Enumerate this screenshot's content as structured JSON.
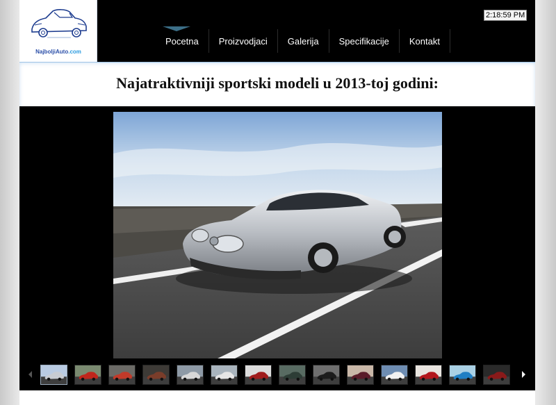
{
  "site": {
    "logo_text_part1": "Najbolji",
    "logo_text_part2": "Auto",
    "logo_text_part3": ".com",
    "clock": "2:18:59 PM"
  },
  "nav": {
    "items": [
      {
        "label": "Pocetna",
        "active": true
      },
      {
        "label": "Proizvodjaci"
      },
      {
        "label": "Galerija"
      },
      {
        "label": "Specifikacije"
      },
      {
        "label": "Kontakt"
      }
    ]
  },
  "main": {
    "title": "Najatraktivniji sportski modeli u 2013-toj godini:"
  },
  "gallery": {
    "main_image_icon": "silver-sports-car-photo",
    "thumbnails": [
      {
        "name": "thumb-1",
        "color": "#c8ccd2",
        "sky": "#b9cbe2",
        "active": true
      },
      {
        "name": "thumb-2",
        "color": "#c0261c",
        "sky": "#7a8a70"
      },
      {
        "name": "thumb-3",
        "color": "#c23a2a",
        "sky": "#6b6a66"
      },
      {
        "name": "thumb-4",
        "color": "#7a3d2a",
        "sky": "#3d3a36"
      },
      {
        "name": "thumb-5",
        "color": "#d8d8d8",
        "sky": "#8e9aa6"
      },
      {
        "name": "thumb-6",
        "color": "#e6e6e6",
        "sky": "#a9b4bd"
      },
      {
        "name": "thumb-7",
        "color": "#a01c1c",
        "sky": "#dcdcdc"
      },
      {
        "name": "thumb-8",
        "color": "#2d3d36",
        "sky": "#586b62"
      },
      {
        "name": "thumb-9",
        "color": "#1c1c1c",
        "sky": "#6e6e6e"
      },
      {
        "name": "thumb-10",
        "color": "#5a1c2a",
        "sky": "#c9b7a8"
      },
      {
        "name": "thumb-11",
        "color": "#f2f2f2",
        "sky": "#6e8db2"
      },
      {
        "name": "thumb-12",
        "color": "#b3171c",
        "sky": "#e8e4df"
      },
      {
        "name": "thumb-13",
        "color": "#1f7fc4",
        "sky": "#a9d0e4"
      },
      {
        "name": "thumb-14",
        "color": "#8a1a1a",
        "sky": "#2a2a2a"
      }
    ]
  }
}
